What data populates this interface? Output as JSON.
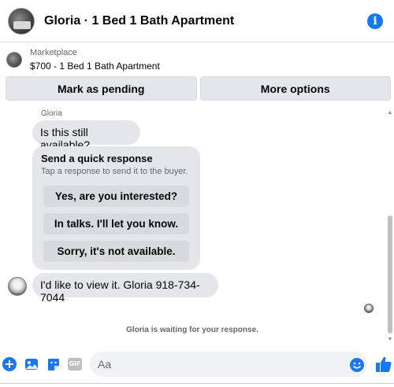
{
  "header": {
    "title": "Gloria · 1 Bed 1 Bath Apartment",
    "info_icon": "info-icon"
  },
  "listing": {
    "source": "Marketplace",
    "price_title": "$700 - 1 Bed 1 Bath Apartment"
  },
  "actions": {
    "pending_label": "Mark as pending",
    "more_label": "More options"
  },
  "chat": {
    "sender_name": "Gloria",
    "messages": [
      {
        "text": "Is this still available?"
      },
      {
        "text": "I'd like to view it. Gloria 918-734-7044"
      }
    ],
    "quick_response": {
      "title": "Send a quick response",
      "subtitle": "Tap a response to send it to the buyer.",
      "options": [
        "Yes, are you interested?",
        "In talks. I'll let you know.",
        "Sorry, it's not available."
      ]
    },
    "status_text": "Gloria is waiting for your response."
  },
  "composer": {
    "placeholder": "Aa",
    "gif_label": "GIF",
    "icons": [
      "plus-icon",
      "photo-icon",
      "sticker-icon",
      "gif-icon",
      "emoji-icon",
      "like-icon"
    ]
  },
  "colors": {
    "accent": "#1877f2",
    "bubble": "#e4e6eb",
    "secondary_text": "#65676b"
  }
}
